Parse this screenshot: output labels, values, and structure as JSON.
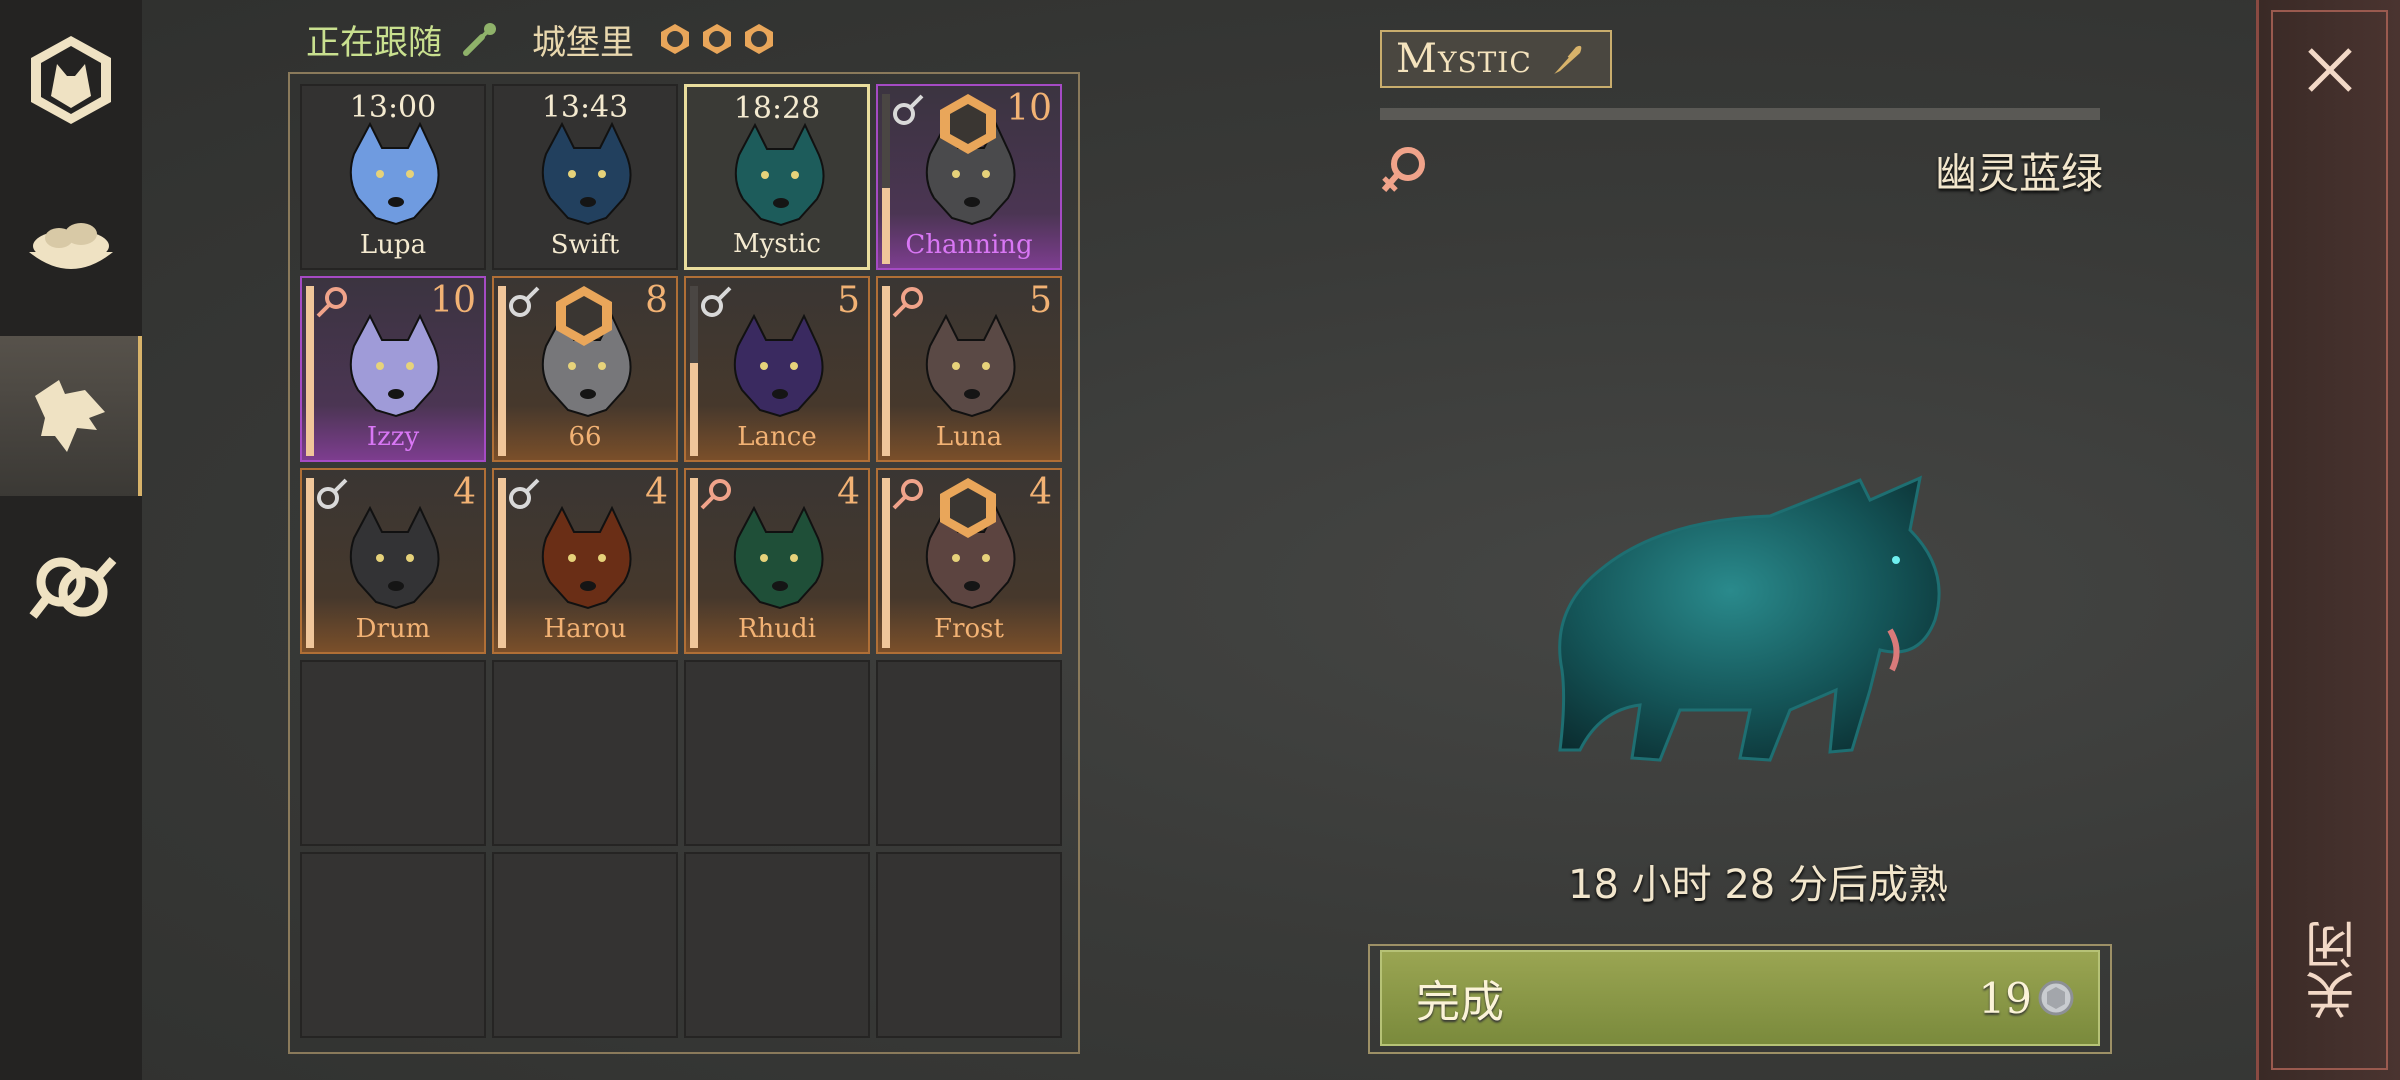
{
  "header": {
    "following_label": "正在跟随",
    "castle_label": "城堡里"
  },
  "nav": {
    "items": [
      {
        "icon": "wolf-crest-icon"
      },
      {
        "icon": "food-bowl-icon"
      },
      {
        "icon": "wolf-head-icon",
        "active": true
      },
      {
        "icon": "gender-pair-icon"
      }
    ]
  },
  "roster": [
    {
      "name": "Lupa",
      "time": "13:00",
      "color": "#6f9be0",
      "rarity": "normal"
    },
    {
      "name": "Swift",
      "time": "13:43",
      "color": "#22405e",
      "rarity": "normal"
    },
    {
      "name": "Mystic",
      "time": "18:28",
      "color": "#1d5c5b",
      "rarity": "normal",
      "selected": true
    },
    {
      "name": "Channing",
      "level": "10",
      "gender": "male",
      "color": "#4a4a4c",
      "rarity": "purple",
      "badge": true,
      "bar": 0.45
    },
    {
      "name": "Izzy",
      "level": "10",
      "gender": "female",
      "color": "#9f9bd8",
      "rarity": "purple",
      "bar": 1.0
    },
    {
      "name": "66",
      "level": "8",
      "gender": "male",
      "color": "#77777a",
      "rarity": "orange",
      "badge": true,
      "bar": 1.0
    },
    {
      "name": "Lance",
      "level": "5",
      "gender": "male",
      "color": "#3a2a60",
      "rarity": "orange",
      "bar": 0.55
    },
    {
      "name": "Luna",
      "level": "5",
      "gender": "female",
      "color": "#5a4945",
      "rarity": "orange",
      "bar": 1.0
    },
    {
      "name": "Drum",
      "level": "4",
      "gender": "male",
      "color": "#333335",
      "rarity": "orange",
      "bar": 1.0
    },
    {
      "name": "Harou",
      "level": "4",
      "gender": "male",
      "color": "#6a2e16",
      "rarity": "orange",
      "bar": 1.0
    },
    {
      "name": "Rhudi",
      "level": "4",
      "gender": "female",
      "color": "#1f4f38",
      "rarity": "orange",
      "bar": 1.0
    },
    {
      "name": "Frost",
      "level": "4",
      "gender": "female",
      "color": "#5c4440",
      "rarity": "orange",
      "badge": true,
      "bar": 1.0
    }
  ],
  "detail": {
    "name": "Mystic",
    "gender": "female",
    "variant": "幽灵蓝绿",
    "growth_progress": 0.0,
    "mature_text": "18 小时 28 分后成熟",
    "complete_label": "完成",
    "complete_cost": "19",
    "accent": "#1a5a5c"
  },
  "close": {
    "label": "关闭"
  }
}
